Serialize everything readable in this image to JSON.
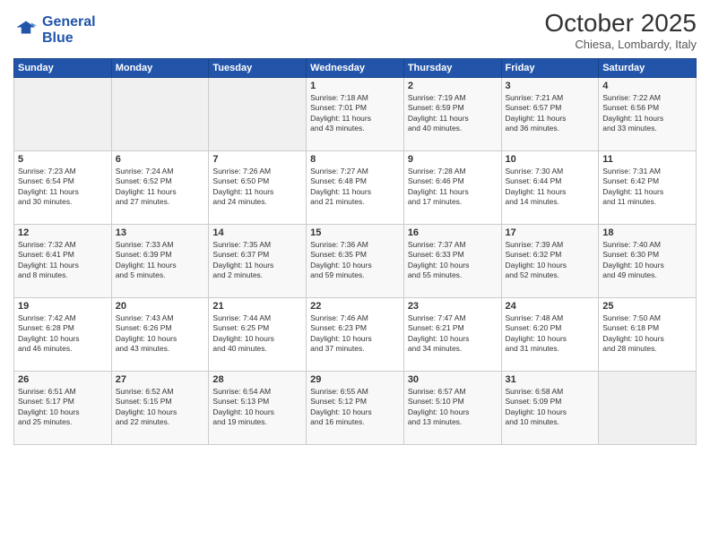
{
  "logo": {
    "line1": "General",
    "line2": "Blue"
  },
  "title": "October 2025",
  "subtitle": "Chiesa, Lombardy, Italy",
  "days_of_week": [
    "Sunday",
    "Monday",
    "Tuesday",
    "Wednesday",
    "Thursday",
    "Friday",
    "Saturday"
  ],
  "weeks": [
    [
      {
        "day": "",
        "info": ""
      },
      {
        "day": "",
        "info": ""
      },
      {
        "day": "",
        "info": ""
      },
      {
        "day": "1",
        "info": "Sunrise: 7:18 AM\nSunset: 7:01 PM\nDaylight: 11 hours\nand 43 minutes."
      },
      {
        "day": "2",
        "info": "Sunrise: 7:19 AM\nSunset: 6:59 PM\nDaylight: 11 hours\nand 40 minutes."
      },
      {
        "day": "3",
        "info": "Sunrise: 7:21 AM\nSunset: 6:57 PM\nDaylight: 11 hours\nand 36 minutes."
      },
      {
        "day": "4",
        "info": "Sunrise: 7:22 AM\nSunset: 6:56 PM\nDaylight: 11 hours\nand 33 minutes."
      }
    ],
    [
      {
        "day": "5",
        "info": "Sunrise: 7:23 AM\nSunset: 6:54 PM\nDaylight: 11 hours\nand 30 minutes."
      },
      {
        "day": "6",
        "info": "Sunrise: 7:24 AM\nSunset: 6:52 PM\nDaylight: 11 hours\nand 27 minutes."
      },
      {
        "day": "7",
        "info": "Sunrise: 7:26 AM\nSunset: 6:50 PM\nDaylight: 11 hours\nand 24 minutes."
      },
      {
        "day": "8",
        "info": "Sunrise: 7:27 AM\nSunset: 6:48 PM\nDaylight: 11 hours\nand 21 minutes."
      },
      {
        "day": "9",
        "info": "Sunrise: 7:28 AM\nSunset: 6:46 PM\nDaylight: 11 hours\nand 17 minutes."
      },
      {
        "day": "10",
        "info": "Sunrise: 7:30 AM\nSunset: 6:44 PM\nDaylight: 11 hours\nand 14 minutes."
      },
      {
        "day": "11",
        "info": "Sunrise: 7:31 AM\nSunset: 6:42 PM\nDaylight: 11 hours\nand 11 minutes."
      }
    ],
    [
      {
        "day": "12",
        "info": "Sunrise: 7:32 AM\nSunset: 6:41 PM\nDaylight: 11 hours\nand 8 minutes."
      },
      {
        "day": "13",
        "info": "Sunrise: 7:33 AM\nSunset: 6:39 PM\nDaylight: 11 hours\nand 5 minutes."
      },
      {
        "day": "14",
        "info": "Sunrise: 7:35 AM\nSunset: 6:37 PM\nDaylight: 11 hours\nand 2 minutes."
      },
      {
        "day": "15",
        "info": "Sunrise: 7:36 AM\nSunset: 6:35 PM\nDaylight: 10 hours\nand 59 minutes."
      },
      {
        "day": "16",
        "info": "Sunrise: 7:37 AM\nSunset: 6:33 PM\nDaylight: 10 hours\nand 55 minutes."
      },
      {
        "day": "17",
        "info": "Sunrise: 7:39 AM\nSunset: 6:32 PM\nDaylight: 10 hours\nand 52 minutes."
      },
      {
        "day": "18",
        "info": "Sunrise: 7:40 AM\nSunset: 6:30 PM\nDaylight: 10 hours\nand 49 minutes."
      }
    ],
    [
      {
        "day": "19",
        "info": "Sunrise: 7:42 AM\nSunset: 6:28 PM\nDaylight: 10 hours\nand 46 minutes."
      },
      {
        "day": "20",
        "info": "Sunrise: 7:43 AM\nSunset: 6:26 PM\nDaylight: 10 hours\nand 43 minutes."
      },
      {
        "day": "21",
        "info": "Sunrise: 7:44 AM\nSunset: 6:25 PM\nDaylight: 10 hours\nand 40 minutes."
      },
      {
        "day": "22",
        "info": "Sunrise: 7:46 AM\nSunset: 6:23 PM\nDaylight: 10 hours\nand 37 minutes."
      },
      {
        "day": "23",
        "info": "Sunrise: 7:47 AM\nSunset: 6:21 PM\nDaylight: 10 hours\nand 34 minutes."
      },
      {
        "day": "24",
        "info": "Sunrise: 7:48 AM\nSunset: 6:20 PM\nDaylight: 10 hours\nand 31 minutes."
      },
      {
        "day": "25",
        "info": "Sunrise: 7:50 AM\nSunset: 6:18 PM\nDaylight: 10 hours\nand 28 minutes."
      }
    ],
    [
      {
        "day": "26",
        "info": "Sunrise: 6:51 AM\nSunset: 5:17 PM\nDaylight: 10 hours\nand 25 minutes."
      },
      {
        "day": "27",
        "info": "Sunrise: 6:52 AM\nSunset: 5:15 PM\nDaylight: 10 hours\nand 22 minutes."
      },
      {
        "day": "28",
        "info": "Sunrise: 6:54 AM\nSunset: 5:13 PM\nDaylight: 10 hours\nand 19 minutes."
      },
      {
        "day": "29",
        "info": "Sunrise: 6:55 AM\nSunset: 5:12 PM\nDaylight: 10 hours\nand 16 minutes."
      },
      {
        "day": "30",
        "info": "Sunrise: 6:57 AM\nSunset: 5:10 PM\nDaylight: 10 hours\nand 13 minutes."
      },
      {
        "day": "31",
        "info": "Sunrise: 6:58 AM\nSunset: 5:09 PM\nDaylight: 10 hours\nand 10 minutes."
      },
      {
        "day": "",
        "info": ""
      }
    ]
  ]
}
